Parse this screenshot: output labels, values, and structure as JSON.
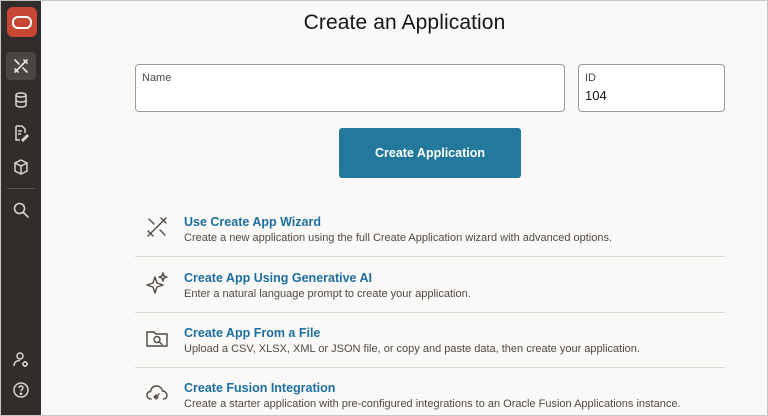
{
  "header": {
    "title": "Create an Application"
  },
  "form": {
    "name_label": "Name",
    "name_value": "",
    "id_label": "ID",
    "id_value": "104",
    "create_button": "Create Application"
  },
  "sidebar": {
    "items": [
      {
        "icon": "oracle-logo-icon"
      },
      {
        "icon": "app-builder-icon",
        "active": true
      },
      {
        "icon": "database-icon"
      },
      {
        "icon": "edit-document-icon"
      },
      {
        "icon": "package-icon"
      },
      {
        "icon": "search-icon"
      },
      {
        "icon": "user-settings-icon"
      },
      {
        "icon": "help-icon"
      }
    ]
  },
  "options": [
    {
      "title": "Use Create App Wizard",
      "description": "Create a new application using the full Create Application wizard with advanced options.",
      "icon": "wizard-icon"
    },
    {
      "title": "Create App Using Generative AI",
      "description": "Enter a natural language prompt to create your application.",
      "icon": "sparkle-icon"
    },
    {
      "title": "Create App From a File",
      "description": "Upload a CSV, XLSX, XML or JSON file, or copy and paste data, then create your application.",
      "icon": "folder-search-icon"
    },
    {
      "title": "Create Fusion Integration",
      "description": "Create a starter application with pre-configured integrations to an Oracle Fusion Applications instance.",
      "icon": "cloud-link-icon"
    }
  ],
  "colors": {
    "accent": "#22799c",
    "link": "#1b6ea0",
    "sidebar": "#312d2a",
    "brand": "#c74634"
  }
}
